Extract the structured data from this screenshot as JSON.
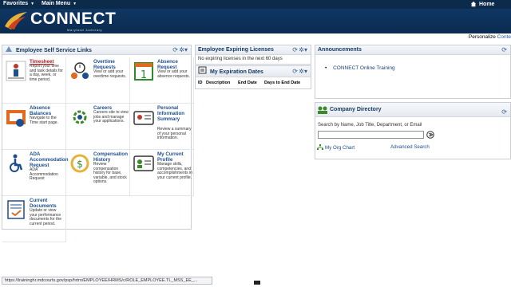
{
  "topbar": {
    "favorites_label": "Favorites",
    "main_menu_label": "Main Menu",
    "home_label": "Home",
    "caret": "▼"
  },
  "banner": {
    "brand": "CONNECT",
    "subtitle": "Maryland Judiciary"
  },
  "personalize": {
    "prefix": "Personalize",
    "link": "Conte"
  },
  "ess": {
    "title": "Employee Self Service Links",
    "refresh": "⟳",
    "options": "✲▾",
    "items": [
      {
        "title": "Timesheet",
        "desc": "Report your time and task details for a day, week, or time period."
      },
      {
        "title": "Overtime Requests",
        "desc": "View or add your overtime requests."
      },
      {
        "title": "Absence Request",
        "desc": "View or add your absence requests."
      },
      {
        "title": "Absence Balances",
        "desc": "Navigate to the Time start page."
      },
      {
        "title": "Careers",
        "desc": "Careers site to view jobs and manage your applications."
      },
      {
        "title": "Personal Information Summary",
        "desc": "Review a summary of your personal information."
      },
      {
        "title": "ADA Accommodation Request",
        "desc": "ADA Accommodation Request"
      },
      {
        "title": "Compensation History",
        "desc": "Review compensation history for base, variable, and stock options."
      },
      {
        "title": "My Current Profile",
        "desc": "Manage skills, competencies, and accomplishments in your current profile."
      },
      {
        "title": "Current Documents",
        "desc": "Update or view your performance documents for the current period."
      }
    ],
    "icons": [
      "timesheet-icon",
      "overtime-icon",
      "calendar-icon",
      "balance-icon",
      "careers-icon",
      "id-card-icon",
      "wheelchair-icon",
      "compensation-icon",
      "profile-icon",
      "document-icon"
    ]
  },
  "licenses": {
    "title": "Employee Expiring Licenses",
    "message": "No expiring licenses in the next 60 days"
  },
  "expiration": {
    "title": "My Expiration Dates",
    "columns": [
      "ID",
      "Description",
      "End Date",
      "Days to End Date"
    ]
  },
  "announcements": {
    "title": "Announcements",
    "items": [
      "CONNECT Online Training"
    ]
  },
  "directory": {
    "title": "Company Directory",
    "search_label": "Search by Name, Job Title, Department, or Email",
    "search_value": "",
    "org_chart": "My Org Chart",
    "advanced": "Advanced Search"
  },
  "status": {
    "url": "https://traininghr.mdcourts.gov/psp/hrtrn/EMPLOYEE/HRMS/c/ROLE_EMPLOYEE.TL_MSS_EE_..."
  },
  "colors": {
    "navy": "#0c2a4a",
    "link_blue": "#1d4f8f",
    "accent_red": "#b42020",
    "accent_orange": "#e26a1f",
    "accent_green": "#3a8a2a"
  }
}
